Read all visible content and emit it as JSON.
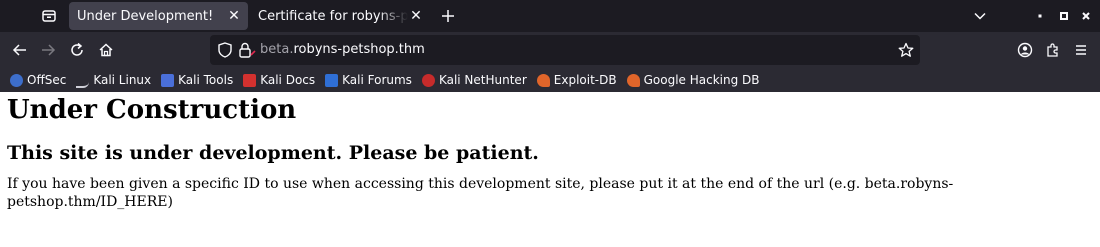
{
  "browser": {
    "tabs": [
      {
        "title": "Under Development!",
        "active": true
      },
      {
        "title": "Certificate for robyns-petshop.thm",
        "active": false
      }
    ],
    "url": {
      "host_prefix": "beta.",
      "host_main": "robyns-petshop.thm"
    },
    "bookmarks": [
      {
        "label": "OffSec",
        "icon": "offsec-icon"
      },
      {
        "label": "Kali Linux",
        "icon": "kali-dragon-icon"
      },
      {
        "label": "Kali Tools",
        "icon": "kali-tools-icon"
      },
      {
        "label": "Kali Docs",
        "icon": "kali-docs-icon"
      },
      {
        "label": "Kali Forums",
        "icon": "kali-forums-icon"
      },
      {
        "label": "Kali NetHunter",
        "icon": "nethunter-icon"
      },
      {
        "label": "Exploit-DB",
        "icon": "exploit-db-icon"
      },
      {
        "label": "Google Hacking DB",
        "icon": "ghdb-icon"
      }
    ]
  },
  "page": {
    "heading": "Under Construction",
    "subheading": "This site is under development. Please be patient.",
    "message": "If you have been given a specific ID to use when accessing this development site, please put it at the end of the url (e.g. beta.robyns-petshop.thm/ID_HERE)"
  }
}
